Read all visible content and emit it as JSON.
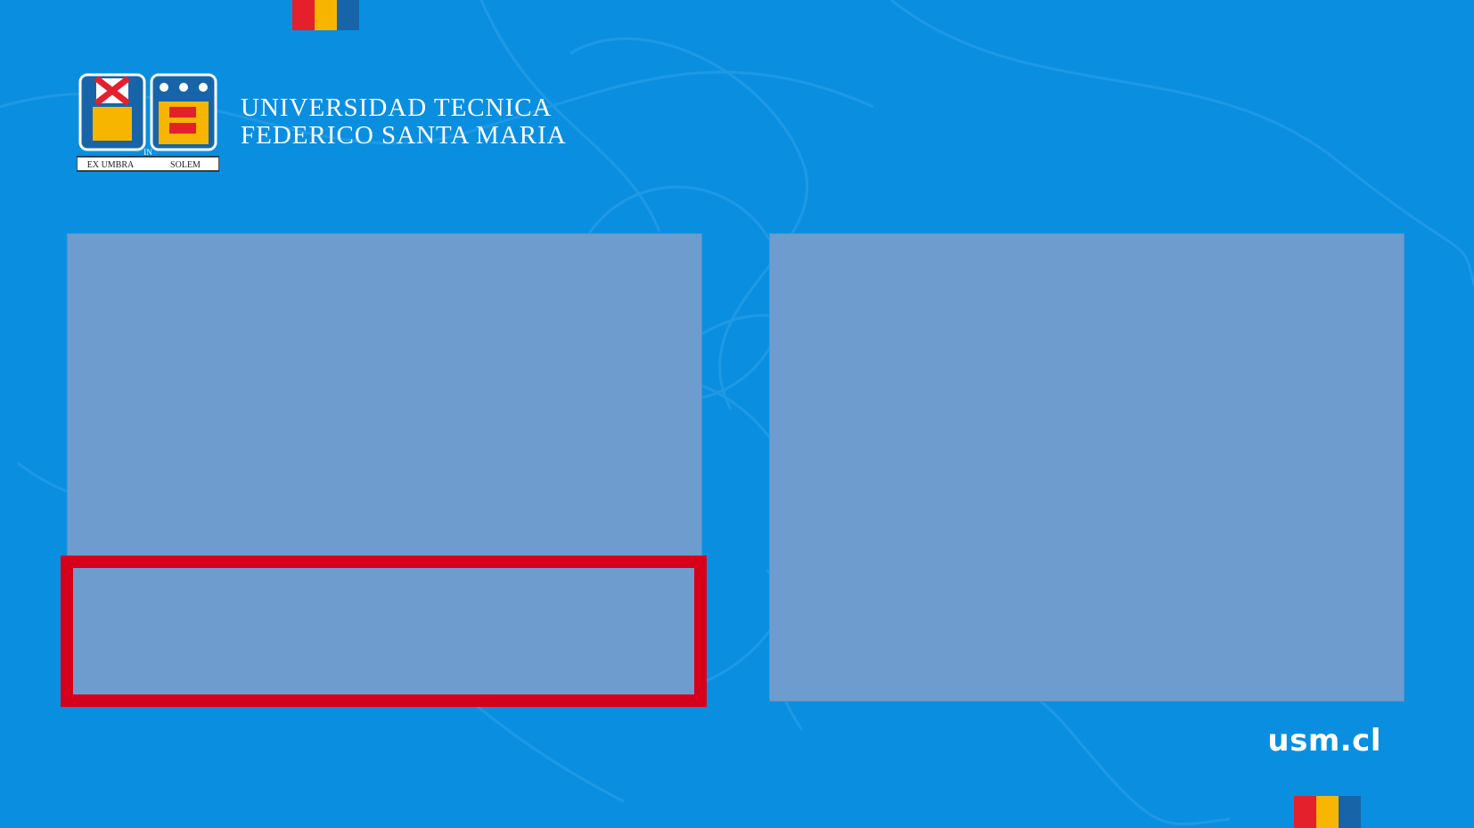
{
  "brand": {
    "line1": "UNIVERSIDAD TECNICA",
    "line2": "FEDERICO SANTA MARIA",
    "crest_motto_left": "EX UMBRA",
    "crest_motto_mid": "IN",
    "crest_motto_right": "SOLEM",
    "colors": {
      "background": "#0a8fe0",
      "stripe_red": "#e3202b",
      "stripe_yellow": "#f7b500",
      "stripe_blue": "#1765a8"
    }
  },
  "panels": {
    "color": "#6f9ccf",
    "highlight_color": "#d7001a"
  },
  "footer": {
    "url": "usm.cl"
  }
}
